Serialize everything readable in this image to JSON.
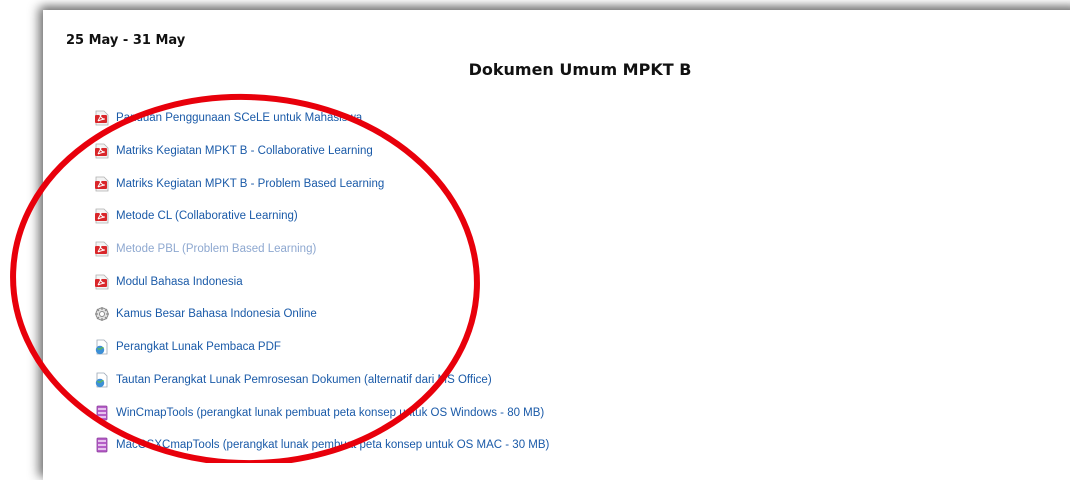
{
  "week": {
    "title": "25 May - 31 May"
  },
  "section": {
    "title": "Dokumen Umum MPKT B"
  },
  "resources": [
    {
      "label": "Panduan Penggunaan SCeLE untuk Mahasiswa",
      "icon": "pdf-icon"
    },
    {
      "label": "Matriks Kegiatan MPKT B - Collaborative Learning",
      "icon": "pdf-icon"
    },
    {
      "label": "Matriks Kegiatan MPKT B - Problem Based Learning",
      "icon": "pdf-icon"
    },
    {
      "label": "Metode CL (Collaborative Learning)",
      "icon": "pdf-icon"
    },
    {
      "label": "Metode PBL (Problem Based Learning)",
      "icon": "pdf-icon",
      "dimmed": true
    },
    {
      "label": "Modul Bahasa Indonesia",
      "icon": "pdf-icon"
    },
    {
      "label": "Kamus Besar Bahasa Indonesia Online",
      "icon": "url-gear-icon"
    },
    {
      "label": "Perangkat Lunak Pembaca PDF",
      "icon": "web-page-icon"
    },
    {
      "label": "Tautan Perangkat Lunak Pemrosesan Dokumen (alternatif dari MS Office)",
      "icon": "web-page-icon"
    },
    {
      "label": "WinCmapTools (perangkat lunak pembuat peta konsep untuk OS Windows - 80 MB)",
      "icon": "archive-icon"
    },
    {
      "label": "MacOSXCmapTools (perangkat lunak pembuat peta konsep untuk OS MAC - 30 MB)",
      "icon": "archive-icon"
    }
  ],
  "colors": {
    "link": "#1a5aa8",
    "link_dimmed": "#8ea8d0",
    "annotation": "#e8000b"
  }
}
